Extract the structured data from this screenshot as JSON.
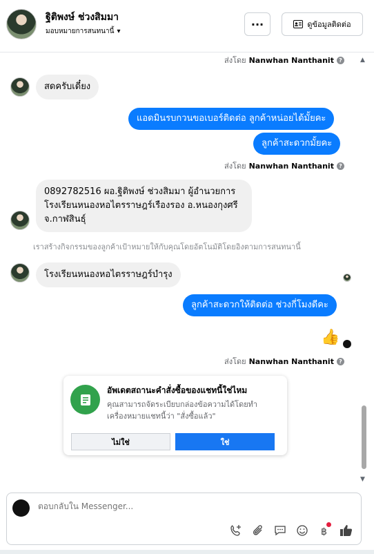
{
  "header": {
    "name": "ฐิติพงษ์ ช่วงสิมมา",
    "assign_label": "มอบหมายการสนทนานี้",
    "more_label": "···",
    "contact_label": "ดูข้อมูลติดต่อ"
  },
  "messages": {
    "sent_by_prefix": "ส่งโดย",
    "agent_name": "Nanwhan Nanthanit",
    "in1": "สดครับเดี๋ยง",
    "out1": "แอดมินรบกวนขอเบอร์ติดต่อ ลูกค้าหน่อยได้มั้ยคะ",
    "out2": "ลูกค้าสะดวกมั้ยคะ",
    "in2": "0892782516 ผอ.ฐิติพงษ์  ช่วงสิมมา  ผู้อำนวยการโรงเรียนหนองหอไตรราษฎร์เรืองรอง อ.หนองกุงศรี จ.กาฬสินธุ์",
    "system_note": "เราสร้างกิจกรรมของลูกค้าเป้าหมายให้กับคุณโดยอัตโนมัติโดยอิงตามการสนทนานี้",
    "in3": "โรงเรียนหนองหอไตรราษฎร์บำรุง",
    "out3": "ลูกค้าสะดวกให้ติดต่อ ช่วงกี่โมงดีคะ"
  },
  "status_card": {
    "title": "อัพเดตสถานะคำสั่งซื้อของแชทนี้ใช่ไหม",
    "body": "คุณสามารถจัดระเบียบกล่องข้อความได้โดยทำเครื่องหมายแชทนี้ว่า \"สั่งซื้อแล้ว\"",
    "no_label": "ไม่ใช่",
    "yes_label": "ใช่"
  },
  "composer": {
    "placeholder": "ตอบกลับใน Messenger..."
  },
  "colors": {
    "accent": "#0a7cff",
    "incoming_bubble": "#f0f0f0",
    "card_icon": "#31a24c"
  }
}
